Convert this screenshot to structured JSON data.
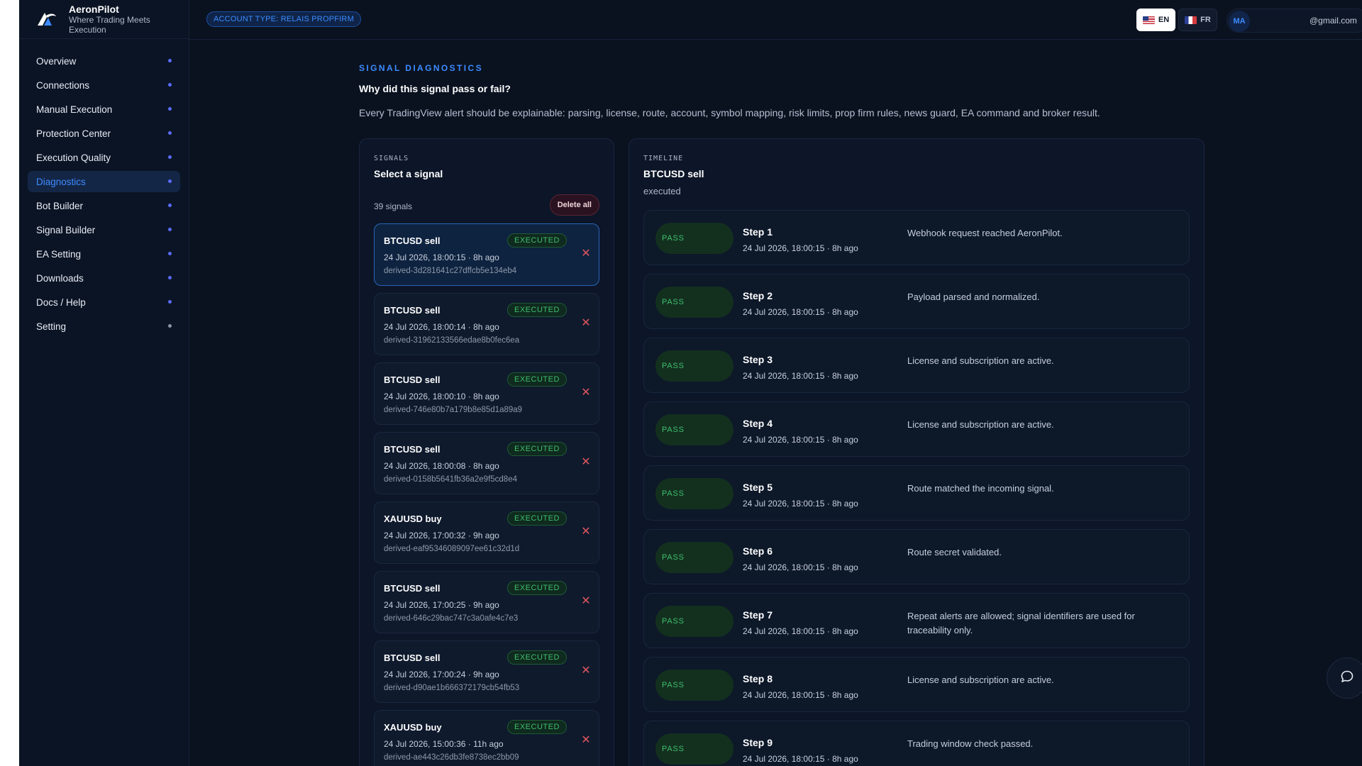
{
  "brand": {
    "name": "AeronPilot",
    "tagline": "Where Trading Meets Execution"
  },
  "sidebar": {
    "items": [
      {
        "label": "Overview",
        "active": false
      },
      {
        "label": "Connections",
        "active": false
      },
      {
        "label": "Manual Execution",
        "active": false
      },
      {
        "label": "Protection Center",
        "active": false
      },
      {
        "label": "Execution Quality",
        "active": false
      },
      {
        "label": "Diagnostics",
        "active": true
      },
      {
        "label": "Bot Builder",
        "active": false
      },
      {
        "label": "Signal Builder",
        "active": false
      },
      {
        "label": "EA Setting",
        "active": false
      },
      {
        "label": "Downloads",
        "active": false
      },
      {
        "label": "Docs / Help",
        "active": false
      },
      {
        "label": "Setting",
        "active": false
      }
    ]
  },
  "topbar": {
    "account_type": "ACCOUNT TYPE: RELAIS PROPFIRM",
    "lang_en": "EN",
    "lang_fr": "FR",
    "avatar_initials": "MA",
    "user_email": "@gmail.com"
  },
  "header": {
    "kicker": "SIGNAL DIAGNOSTICS",
    "title": "Why did this signal pass or fail?",
    "description": "Every TradingView alert should be explainable: parsing, license, route, account, symbol mapping, risk limits, prop firm rules, news guard, EA command and broker result."
  },
  "signals": {
    "kicker": "SIGNALS",
    "title": "Select a signal",
    "count": "39 signals",
    "delete_all": "Delete all",
    "items": [
      {
        "name": "BTCUSD sell",
        "status": "EXECUTED",
        "time": "24 Jul 2026, 18:00:15 · 8h ago",
        "id": "derived-3d281641c27dffcb5e134eb4"
      },
      {
        "name": "BTCUSD sell",
        "status": "EXECUTED",
        "time": "24 Jul 2026, 18:00:14 · 8h ago",
        "id": "derived-31962133566edae8b0fec6ea"
      },
      {
        "name": "BTCUSD sell",
        "status": "EXECUTED",
        "time": "24 Jul 2026, 18:00:10 · 8h ago",
        "id": "derived-746e80b7a179b8e85d1a89a9"
      },
      {
        "name": "BTCUSD sell",
        "status": "EXECUTED",
        "time": "24 Jul 2026, 18:00:08 · 8h ago",
        "id": "derived-0158b5641fb36a2e9f5cd8e4"
      },
      {
        "name": "XAUUSD buy",
        "status": "EXECUTED",
        "time": "24 Jul 2026, 17:00:32 · 9h ago",
        "id": "derived-eaf95346089097ee61c32d1d"
      },
      {
        "name": "BTCUSD sell",
        "status": "EXECUTED",
        "time": "24 Jul 2026, 17:00:25 · 9h ago",
        "id": "derived-646c29bac747c3a0afe4c7e3"
      },
      {
        "name": "BTCUSD sell",
        "status": "EXECUTED",
        "time": "24 Jul 2026, 17:00:24 · 9h ago",
        "id": "derived-d90ae1b666372179cb54fb53"
      },
      {
        "name": "XAUUSD buy",
        "status": "EXECUTED",
        "time": "24 Jul 2026, 15:00:36 · 11h ago",
        "id": "derived-ae443c26db3fe8738ec2bb09"
      }
    ]
  },
  "timeline": {
    "kicker": "TIMELINE",
    "title": "BTCUSD sell",
    "subtitle": "executed",
    "steps": [
      {
        "status": "PASS",
        "title": "Step 1",
        "time": "24 Jul 2026, 18:00:15 · 8h ago",
        "message": "Webhook request reached AeronPilot."
      },
      {
        "status": "PASS",
        "title": "Step 2",
        "time": "24 Jul 2026, 18:00:15 · 8h ago",
        "message": "Payload parsed and normalized."
      },
      {
        "status": "PASS",
        "title": "Step 3",
        "time": "24 Jul 2026, 18:00:15 · 8h ago",
        "message": "License and subscription are active."
      },
      {
        "status": "PASS",
        "title": "Step 4",
        "time": "24 Jul 2026, 18:00:15 · 8h ago",
        "message": "License and subscription are active."
      },
      {
        "status": "PASS",
        "title": "Step 5",
        "time": "24 Jul 2026, 18:00:15 · 8h ago",
        "message": "Route matched the incoming signal."
      },
      {
        "status": "PASS",
        "title": "Step 6",
        "time": "24 Jul 2026, 18:00:15 · 8h ago",
        "message": "Route secret validated."
      },
      {
        "status": "PASS",
        "title": "Step 7",
        "time": "24 Jul 2026, 18:00:15 · 8h ago",
        "message": "Repeat alerts are allowed; signal identifiers are used for traceability only."
      },
      {
        "status": "PASS",
        "title": "Step 8",
        "time": "24 Jul 2026, 18:00:15 · 8h ago",
        "message": "License and subscription are active."
      },
      {
        "status": "PASS",
        "title": "Step 9",
        "time": "24 Jul 2026, 18:00:15 · 8h ago",
        "message": "Trading window check passed."
      }
    ]
  },
  "icons": {
    "logo": "aeronpilot-logo-icon",
    "close": "close-icon",
    "chat": "chat-icon",
    "chevron": "chevron-down-icon"
  },
  "colors": {
    "accent": "#3d8bff",
    "pass": "#3fbf6d",
    "danger": "#e0565f",
    "background": "#0a1220"
  }
}
